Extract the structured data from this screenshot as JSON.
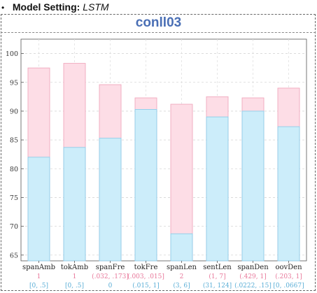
{
  "header": {
    "bullet": "•",
    "label": "Model Setting:",
    "value": "LSTM"
  },
  "chart_data": {
    "type": "bar",
    "title": "conll03",
    "categories": [
      "spanAmb",
      "tokAmb",
      "spanFre",
      "tokFre",
      "spanLen",
      "sentLen",
      "spanDen",
      "oovDen"
    ],
    "bucket_labels_top": [
      "1",
      "1",
      "(.032, .173]",
      "(.003, .015]",
      "2",
      "(1, 7]",
      "(.429, 1]",
      "(.203, 1]"
    ],
    "bucket_labels_bottom": [
      "[0, .5]",
      "[0, .5]",
      "0",
      "(.015, 1]",
      "(3, 6]",
      "(31, 124]",
      "(.0222, .15]",
      "[0, .0667]"
    ],
    "series": [
      {
        "values": [
          82.0,
          83.7,
          85.3,
          90.3,
          68.7,
          89.0,
          90.0,
          87.3
        ]
      },
      {
        "values": [
          97.5,
          98.3,
          94.6,
          92.3,
          91.2,
          92.5,
          92.3,
          94.0
        ]
      }
    ],
    "ylim": [
      64,
      102.5
    ],
    "yticks": [
      65,
      70,
      75,
      80,
      85,
      90,
      95,
      100
    ],
    "grid": true,
    "colors": {
      "low_fill": "#ccedfa",
      "low_stroke": "#8fcde8",
      "high_fill": "#fddde6",
      "high_stroke": "#f0a8bd",
      "top_label": "#e8779a",
      "bottom_label": "#5aaed6",
      "title": "#4a6fb5"
    }
  }
}
